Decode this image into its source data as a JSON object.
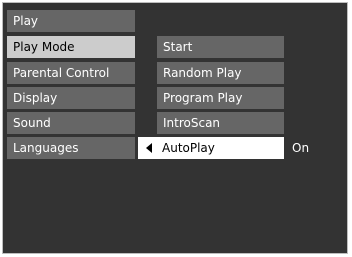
{
  "left_menu": {
    "items": [
      {
        "label": "Play"
      },
      {
        "label": "Play Mode"
      },
      {
        "label": "Parental Control"
      },
      {
        "label": "Display"
      },
      {
        "label": "Sound"
      },
      {
        "label": "Languages"
      }
    ],
    "selected_label": "Play Mode"
  },
  "submenu": {
    "items": [
      {
        "label": "Start"
      },
      {
        "label": "Random Play"
      },
      {
        "label": "Program Play"
      },
      {
        "label": "IntroScan"
      },
      {
        "label": "AutoPlay"
      }
    ],
    "active_label": "AutoPlay",
    "active_value": "On"
  },
  "icons": {
    "active_item_arrow": "triangle-left-icon"
  },
  "colors": {
    "background": "#333333",
    "item": "#666666",
    "selected_item": "#cccccc",
    "active_item": "#ffffff"
  }
}
